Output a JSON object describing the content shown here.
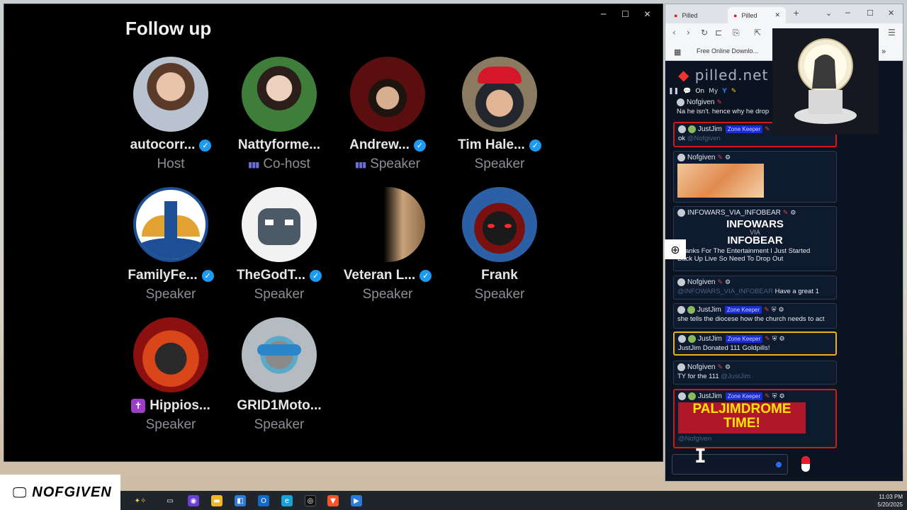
{
  "left_window": {
    "title": "Follow up",
    "controls": [
      "─",
      "☐",
      "✕"
    ],
    "participants": [
      {
        "name": "autocorr...",
        "role": "Host",
        "verified": true,
        "speaking": false
      },
      {
        "name": "Nattyforme...",
        "role": "Co-host",
        "verified": false,
        "speaking": true
      },
      {
        "name": "Andrew...",
        "role": "Speaker",
        "verified": true,
        "speaking": true
      },
      {
        "name": "Tim Hale...",
        "role": "Speaker",
        "verified": true,
        "speaking": false
      },
      {
        "name": "FamilyFe...",
        "role": "Speaker",
        "verified": true,
        "speaking": false
      },
      {
        "name": "TheGodT...",
        "role": "Speaker",
        "verified": true,
        "speaking": false
      },
      {
        "name": "Veteran L...",
        "role": "Speaker",
        "verified": true,
        "speaking": false
      },
      {
        "name": "Frank",
        "role": "Speaker",
        "verified": false,
        "speaking": false
      },
      {
        "name": "Hippios...",
        "role": "Speaker",
        "verified": false,
        "speaking": false,
        "badge": "✝"
      },
      {
        "name": "GRID1Moto...",
        "role": "Speaker",
        "verified": false,
        "speaking": false
      }
    ]
  },
  "browser": {
    "tabs": [
      {
        "label": "Pilled",
        "active": false
      },
      {
        "label": "Pilled",
        "active": true
      }
    ],
    "tab_close": "✕",
    "new_tab": "+",
    "window_controls": [
      "⌄",
      "─",
      "☐",
      "✕"
    ],
    "nav": [
      "‹",
      "›",
      "↻",
      "⊏",
      "⎘",
      "⇱"
    ],
    "menu": "☰",
    "bookmark_label": "Free Online Downlo...",
    "bookmarks_more": "»",
    "site": {
      "logo_text": "pilled.net",
      "toolbar": {
        "pause": "❚❚",
        "chat": "💬",
        "on": "On",
        "my": "My",
        "y": "Y",
        "pen": "✎"
      },
      "messages": [
        {
          "user": "Nofgiven",
          "body": "Na he isn't. hence why he drop",
          "style": "plain",
          "zone": ""
        },
        {
          "user": "JustJim",
          "zone": "Zone Keeper",
          "body": "ok",
          "mention": "@Nofgiven",
          "style": "red"
        },
        {
          "user": "Nofgiven",
          "body": "",
          "style": "plain",
          "zone": "",
          "image": true
        },
        {
          "user": "INFOWARS_VIA_INFOBEAR",
          "body": "Thanks For The Entertainment I Just Started",
          "body2": "Back Up Live So Need To Drop Out",
          "style": "plain",
          "zone": "",
          "logo_line1": "INFOWARS",
          "logo_line2": "VIA",
          "logo_line3": "INFOBEAR"
        },
        {
          "user": "Nofgiven",
          "mention": "@INFOWARS_VIA_INFOBEAR",
          "body": "Have a great 1",
          "style": "plain",
          "zone": ""
        },
        {
          "user": "JustJim",
          "zone": "Zone Keeper",
          "body": "she tells the diocese how the church needs to act",
          "style": "plain"
        },
        {
          "user": "JustJim",
          "zone": "Zone Keeper",
          "body": "JustJim Donated 111 Goldpills!",
          "style": "gold"
        },
        {
          "user": "Nofgiven",
          "body": "TY for the 111",
          "mention": "@JustJim",
          "style": "plain",
          "zone": ""
        },
        {
          "user": "JustJim",
          "zone": "Zone Keeper",
          "banner_line1": "PALJIMDROME",
          "banner_line2": "TIME!",
          "mention": "@Nofgiven",
          "style": "red"
        }
      ]
    }
  },
  "overlay": {
    "zoom_icon": "⊕"
  },
  "taskbar": {
    "brand": "NOFGIVEN",
    "monitor_icon": "🖵",
    "time": "11:03 PM",
    "date": "5/20/2025"
  },
  "colors": {
    "verified": "#1d9bf0",
    "zone_keeper": "#1a2ccf",
    "alert_red": "#d11a1a",
    "gold": "#e9b020"
  }
}
